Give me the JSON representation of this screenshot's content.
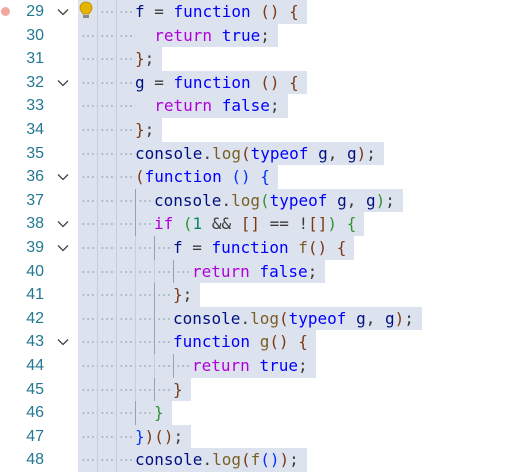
{
  "editor": {
    "breakpoint_color": "#f2a7a2",
    "selection_color": "#dde3ee",
    "lines": [
      {
        "number": "29",
        "indent": 3,
        "fold": true,
        "breakpoint": true,
        "lightbulb": true,
        "tokens": [
          {
            "t": "f",
            "c": "v"
          },
          {
            "t": " = ",
            "c": "p"
          },
          {
            "t": "function",
            "c": "k"
          },
          {
            "t": " ",
            "c": "p"
          },
          {
            "t": "()",
            "c": "b3"
          },
          {
            "t": " ",
            "c": "p"
          },
          {
            "t": "{",
            "c": "b3"
          }
        ]
      },
      {
        "number": "30",
        "indent": 3,
        "fold": false,
        "tokens": [
          {
            "t": "  ",
            "c": "p"
          },
          {
            "t": "return",
            "c": "c"
          },
          {
            "t": " ",
            "c": "p"
          },
          {
            "t": "true",
            "c": "k"
          },
          {
            "t": ";",
            "c": "p"
          }
        ]
      },
      {
        "number": "31",
        "indent": 3,
        "fold": false,
        "tokens": [
          {
            "t": "}",
            "c": "b3"
          },
          {
            "t": ";",
            "c": "p"
          }
        ]
      },
      {
        "number": "32",
        "indent": 3,
        "fold": true,
        "tokens": [
          {
            "t": "g",
            "c": "v"
          },
          {
            "t": " = ",
            "c": "p"
          },
          {
            "t": "function",
            "c": "k"
          },
          {
            "t": " ",
            "c": "p"
          },
          {
            "t": "()",
            "c": "b3"
          },
          {
            "t": " ",
            "c": "p"
          },
          {
            "t": "{",
            "c": "b3"
          }
        ]
      },
      {
        "number": "33",
        "indent": 3,
        "fold": false,
        "tokens": [
          {
            "t": "  ",
            "c": "p"
          },
          {
            "t": "return",
            "c": "c"
          },
          {
            "t": " ",
            "c": "p"
          },
          {
            "t": "false",
            "c": "k"
          },
          {
            "t": ";",
            "c": "p"
          }
        ]
      },
      {
        "number": "34",
        "indent": 3,
        "fold": false,
        "tokens": [
          {
            "t": "}",
            "c": "b3"
          },
          {
            "t": ";",
            "c": "p"
          }
        ]
      },
      {
        "number": "35",
        "indent": 3,
        "fold": false,
        "tokens": [
          {
            "t": "console",
            "c": "v"
          },
          {
            "t": ".",
            "c": "p"
          },
          {
            "t": "log",
            "c": "f"
          },
          {
            "t": "(",
            "c": "b3"
          },
          {
            "t": "typeof",
            "c": "k"
          },
          {
            "t": " ",
            "c": "p"
          },
          {
            "t": "g",
            "c": "v"
          },
          {
            "t": ", ",
            "c": "p"
          },
          {
            "t": "g",
            "c": "v"
          },
          {
            "t": ")",
            "c": "b3"
          },
          {
            "t": ";",
            "c": "p"
          }
        ]
      },
      {
        "number": "36",
        "indent": 3,
        "fold": true,
        "tokens": [
          {
            "t": "(",
            "c": "b3"
          },
          {
            "t": "function",
            "c": "k"
          },
          {
            "t": " ",
            "c": "p"
          },
          {
            "t": "()",
            "c": "b1"
          },
          {
            "t": " ",
            "c": "p"
          },
          {
            "t": "{",
            "c": "b1"
          }
        ]
      },
      {
        "number": "37",
        "indent": 4,
        "fold": false,
        "tokens": [
          {
            "t": "console",
            "c": "v"
          },
          {
            "t": ".",
            "c": "p"
          },
          {
            "t": "log",
            "c": "f"
          },
          {
            "t": "(",
            "c": "b2"
          },
          {
            "t": "typeof",
            "c": "k"
          },
          {
            "t": " ",
            "c": "p"
          },
          {
            "t": "g",
            "c": "v"
          },
          {
            "t": ", ",
            "c": "p"
          },
          {
            "t": "g",
            "c": "v"
          },
          {
            "t": ")",
            "c": "b2"
          },
          {
            "t": ";",
            "c": "p"
          }
        ]
      },
      {
        "number": "38",
        "indent": 4,
        "fold": true,
        "tokens": [
          {
            "t": "if",
            "c": "c"
          },
          {
            "t": " ",
            "c": "p"
          },
          {
            "t": "(",
            "c": "b2"
          },
          {
            "t": "1",
            "c": "n"
          },
          {
            "t": " && ",
            "c": "p"
          },
          {
            "t": "[]",
            "c": "b3"
          },
          {
            "t": " == !",
            "c": "p"
          },
          {
            "t": "[]",
            "c": "b3"
          },
          {
            "t": ")",
            "c": "b2"
          },
          {
            "t": " ",
            "c": "p"
          },
          {
            "t": "{",
            "c": "b2"
          }
        ]
      },
      {
        "number": "39",
        "indent": 5,
        "fold": true,
        "tokens": [
          {
            "t": "f",
            "c": "v"
          },
          {
            "t": " = ",
            "c": "p"
          },
          {
            "t": "function",
            "c": "k"
          },
          {
            "t": " ",
            "c": "p"
          },
          {
            "t": "f",
            "c": "f"
          },
          {
            "t": "()",
            "c": "b3"
          },
          {
            "t": " ",
            "c": "p"
          },
          {
            "t": "{",
            "c": "b3"
          }
        ]
      },
      {
        "number": "40",
        "indent": 6,
        "fold": false,
        "tokens": [
          {
            "t": "return",
            "c": "c"
          },
          {
            "t": " ",
            "c": "p"
          },
          {
            "t": "false",
            "c": "k"
          },
          {
            "t": ";",
            "c": "p"
          }
        ]
      },
      {
        "number": "41",
        "indent": 5,
        "fold": false,
        "tokens": [
          {
            "t": "}",
            "c": "b3"
          },
          {
            "t": ";",
            "c": "p"
          }
        ]
      },
      {
        "number": "42",
        "indent": 5,
        "fold": false,
        "tokens": [
          {
            "t": "console",
            "c": "v"
          },
          {
            "t": ".",
            "c": "p"
          },
          {
            "t": "log",
            "c": "f"
          },
          {
            "t": "(",
            "c": "b3"
          },
          {
            "t": "typeof",
            "c": "k"
          },
          {
            "t": " ",
            "c": "p"
          },
          {
            "t": "g",
            "c": "v"
          },
          {
            "t": ", ",
            "c": "p"
          },
          {
            "t": "g",
            "c": "v"
          },
          {
            "t": ")",
            "c": "b3"
          },
          {
            "t": ";",
            "c": "p"
          }
        ]
      },
      {
        "number": "43",
        "indent": 5,
        "fold": true,
        "tokens": [
          {
            "t": "function",
            "c": "k"
          },
          {
            "t": " ",
            "c": "p"
          },
          {
            "t": "g",
            "c": "f"
          },
          {
            "t": "()",
            "c": "b3"
          },
          {
            "t": " ",
            "c": "p"
          },
          {
            "t": "{",
            "c": "b3"
          }
        ]
      },
      {
        "number": "44",
        "indent": 6,
        "fold": false,
        "tokens": [
          {
            "t": "return",
            "c": "c"
          },
          {
            "t": " ",
            "c": "p"
          },
          {
            "t": "true",
            "c": "k"
          },
          {
            "t": ";",
            "c": "p"
          }
        ]
      },
      {
        "number": "45",
        "indent": 5,
        "fold": false,
        "tokens": [
          {
            "t": "}",
            "c": "b3"
          }
        ]
      },
      {
        "number": "46",
        "indent": 4,
        "fold": false,
        "tokens": [
          {
            "t": "}",
            "c": "b2"
          }
        ]
      },
      {
        "number": "47",
        "indent": 3,
        "fold": false,
        "tokens": [
          {
            "t": "}",
            "c": "b1"
          },
          {
            "t": ")",
            "c": "b3"
          },
          {
            "t": "()",
            "c": "b3"
          },
          {
            "t": ";",
            "c": "p"
          }
        ]
      },
      {
        "number": "48",
        "indent": 3,
        "fold": false,
        "tokens": [
          {
            "t": "console",
            "c": "v"
          },
          {
            "t": ".",
            "c": "p"
          },
          {
            "t": "log",
            "c": "f"
          },
          {
            "t": "(",
            "c": "b3"
          },
          {
            "t": "f",
            "c": "f"
          },
          {
            "t": "()",
            "c": "b1"
          },
          {
            "t": ")",
            "c": "b3"
          },
          {
            "t": ";",
            "c": "p"
          }
        ]
      }
    ]
  }
}
